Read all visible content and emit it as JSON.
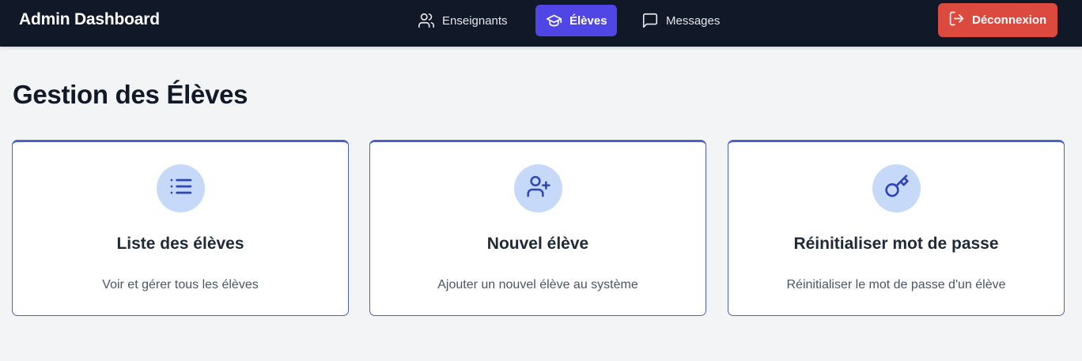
{
  "header": {
    "brand": "Admin Dashboard",
    "nav": [
      {
        "label": "Enseignants",
        "icon": "users-icon",
        "active": false
      },
      {
        "label": "Élèves",
        "icon": "graduation-cap-icon",
        "active": true
      },
      {
        "label": "Messages",
        "icon": "message-square-icon",
        "active": false
      }
    ],
    "logout_label": "Déconnexion",
    "logout_icon": "log-out-icon"
  },
  "main": {
    "title": "Gestion des Élèves",
    "cards": [
      {
        "icon": "list-icon",
        "title": "Liste des élèves",
        "description": "Voir et gérer tous les élèves"
      },
      {
        "icon": "user-plus-icon",
        "title": "Nouvel élève",
        "description": "Ajouter un nouvel élève au système"
      },
      {
        "icon": "key-icon",
        "title": "Réinitialiser mot de passe",
        "description": "Réinitialiser le mot de passe d'un élève"
      }
    ]
  },
  "colors": {
    "topbar": "#111827",
    "active_nav": "#4f46e5",
    "logout": "#dc4a3f",
    "card_border": "#4a62c4",
    "icon_bg": "#c7d9f8",
    "icon_stroke": "#2f45b8",
    "page_bg": "#f3f4f6"
  }
}
